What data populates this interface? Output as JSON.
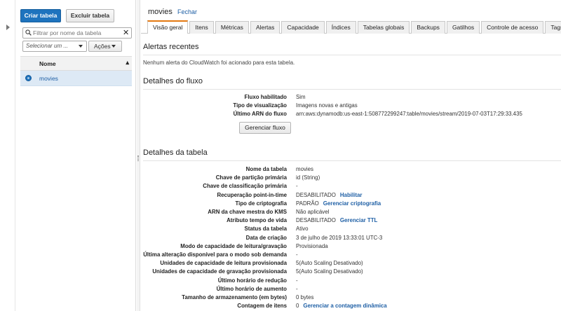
{
  "sidebar": {
    "create_table_label": "Criar tabela",
    "delete_table_label": "Excluir tabela",
    "filter_placeholder": "Filtrar por nome da tabela",
    "select_placeholder": "Selecionar um ...",
    "actions_label": "Ações",
    "column_header": "Nome",
    "tables": [
      "movies"
    ]
  },
  "header": {
    "table_name": "movies",
    "close_label": "Fechar"
  },
  "tabs": [
    "Visão geral",
    "Itens",
    "Métricas",
    "Alertas",
    "Capacidade",
    "Índices",
    "Tabelas globais",
    "Backups",
    "Gatilhos",
    "Controle de acesso",
    "Tags"
  ],
  "active_tab": "Visão geral",
  "recent_alerts": {
    "title": "Alertas recentes",
    "message": "Nenhum alerta do CloudWatch foi acionado para esta tabela."
  },
  "stream_details": {
    "title": "Detalhes do fluxo",
    "rows": [
      {
        "label": "Fluxo habilitado",
        "value": "Sim"
      },
      {
        "label": "Tipo de visualização",
        "value": "Imagens novas e antigas"
      },
      {
        "label": "Último ARN do fluxo",
        "value": "arn:aws:dynamodb:us-east-1:508772299247:table/movies/stream/2019-07-03T17:29:33.435"
      }
    ],
    "manage_button": "Gerenciar fluxo"
  },
  "table_details": {
    "title": "Detalhes da tabela",
    "rows": [
      {
        "label": "Nome da tabela",
        "value": "movies",
        "link": ""
      },
      {
        "label": "Chave de partição primária",
        "value": "id (String)",
        "link": ""
      },
      {
        "label": "Chave de classificação primária",
        "value": "-",
        "link": ""
      },
      {
        "label": "Recuperação point-in-time",
        "value": "DESABILITADO",
        "link": "Habilitar"
      },
      {
        "label": "Tipo de criptografia",
        "value": "PADRÃO",
        "link": "Gerenciar criptografia"
      },
      {
        "label": "ARN da chave mestra do KMS",
        "value": "Não aplicável",
        "link": ""
      },
      {
        "label": "Atributo tempo de vida",
        "value": "DESABILITADO",
        "link": "Gerenciar TTL"
      },
      {
        "label": "Status da tabela",
        "value": "Ativo",
        "link": ""
      },
      {
        "label": "Data de criação",
        "value": "3 de julho de 2019 13:33:01 UTC-3",
        "link": ""
      },
      {
        "label": "Modo de capacidade de leitura/gravação",
        "value": "Provisionada",
        "link": ""
      },
      {
        "label": "Última alteração disponível para o modo sob demanda",
        "value": "-",
        "link": ""
      },
      {
        "label": "Unidades de capacidade de leitura provisionada",
        "value": "5(Auto Scaling Desativado)",
        "link": ""
      },
      {
        "label": "Unidades de capacidade de gravação provisionada",
        "value": "5(Auto Scaling Desativado)",
        "link": ""
      },
      {
        "label": "Último horário de redução",
        "value": "-",
        "link": ""
      },
      {
        "label": "Último horário de aumento",
        "value": "-",
        "link": ""
      },
      {
        "label": "Tamanho de armazenamento (em bytes)",
        "value": "0 bytes",
        "link": ""
      },
      {
        "label": "Contagem de itens",
        "value": "0",
        "link": "Gerenciar a contagem dinâmica"
      }
    ]
  }
}
